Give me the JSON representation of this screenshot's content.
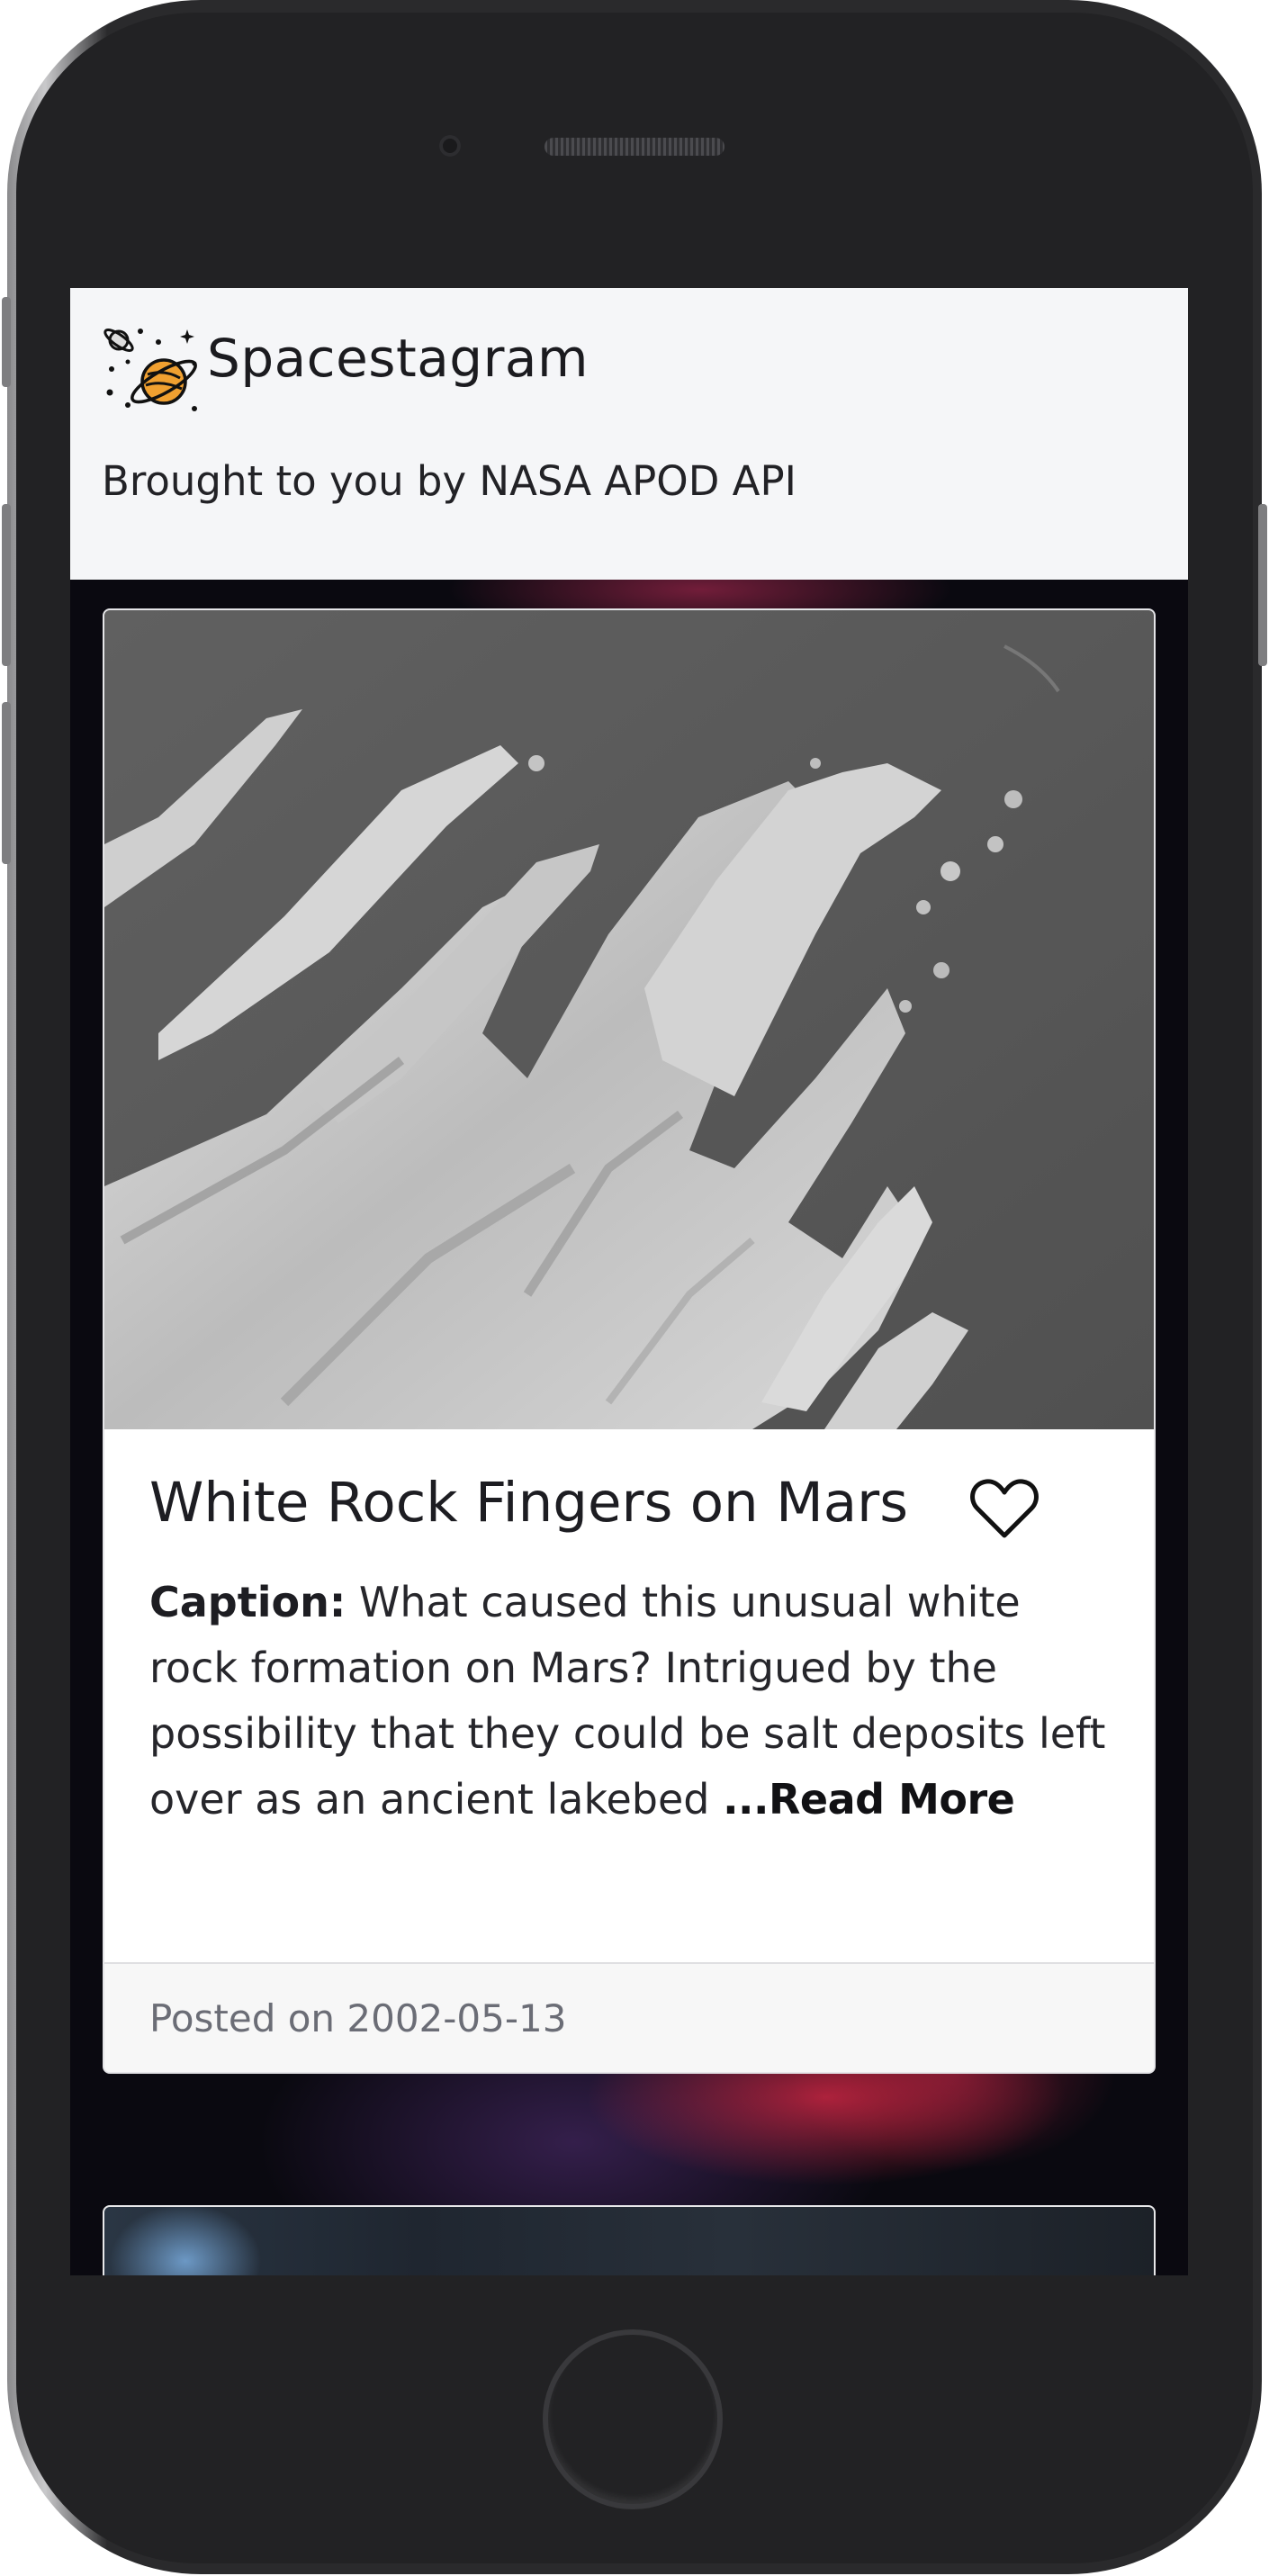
{
  "header": {
    "app_title": "Spacestagram",
    "subtitle": "Brought to you by NASA APOD API",
    "logo_icon": "planet-stars-icon"
  },
  "post": {
    "title": "White Rock Fingers on Mars",
    "caption_label": "Caption:",
    "caption_text": " What caused this unusual white rock formation on Mars? Intrigued by the possibility that they could be salt deposits left over as an ancient lakebed ",
    "read_more": "...Read More",
    "posted_on": "Posted on 2002-05-13",
    "like_icon": "heart-outline-icon",
    "liked": false
  },
  "colors": {
    "header_bg": "#f5f6f8",
    "card_bg": "#ffffff",
    "footer_bg": "#f7f7f7",
    "muted_text": "#6b6d76",
    "planet_orange": "#f0a030"
  }
}
